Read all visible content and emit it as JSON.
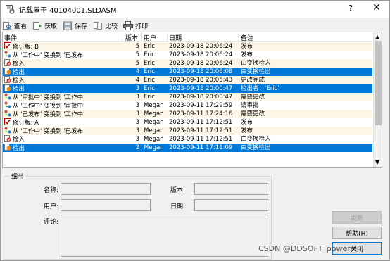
{
  "window": {
    "title": "记载屋于 40104001.SLDASM",
    "help_label": "?",
    "close_label": "✕"
  },
  "toolbar": {
    "items": [
      {
        "label": "查看",
        "icon": "view-icon"
      },
      {
        "label": "获取",
        "icon": "get-icon"
      },
      {
        "label": "保存",
        "icon": "save-icon"
      },
      {
        "label": "比较",
        "icon": "compare-icon"
      },
      {
        "label": "打印",
        "icon": "print-icon"
      }
    ]
  },
  "list": {
    "columns": {
      "event": "事件",
      "version": "版本",
      "user": "用户",
      "date": "日期",
      "note": "备注"
    },
    "rows": [
      {
        "event": "修订版: B",
        "version": "5",
        "user": "Eric",
        "date": "2023-09-18 20:06:24",
        "note": "发布",
        "icon": "revision-icon",
        "style": "cream"
      },
      {
        "event": "从 '工作中' 变换到 '已发布'",
        "version": "5",
        "user": "Eric",
        "date": "2023-09-18 20:06:24",
        "note": "发布",
        "icon": "transition-icon",
        "style": "white"
      },
      {
        "event": "检入",
        "version": "5",
        "user": "Eric",
        "date": "2023-09-18 20:06:24",
        "note": "由变换检入",
        "icon": "checkin-icon",
        "style": "cream"
      },
      {
        "event": "检出",
        "version": "4",
        "user": "Eric",
        "date": "2023-09-18 20:06:08",
        "note": "由变换检出",
        "icon": "checkout-icon",
        "style": "sel"
      },
      {
        "event": "检入",
        "version": "4",
        "user": "Eric",
        "date": "2023-09-18 20:05:43",
        "note": "更改完成",
        "icon": "checkin-icon",
        "style": "cream"
      },
      {
        "event": "检出",
        "version": "3",
        "user": "Eric",
        "date": "2023-09-18 20:00:47",
        "note": "检出者：'Eric'",
        "icon": "checkout-icon",
        "style": "sel"
      },
      {
        "event": "从 '审批中' 变换到 '工作中'",
        "version": "3",
        "user": "Eric",
        "date": "2023-09-18 20:00:47",
        "note": "需要更改",
        "icon": "transition-icon",
        "style": "cream"
      },
      {
        "event": "从 '工作中' 变换到 '审批中'",
        "version": "3",
        "user": "Megan",
        "date": "2023-09-11 17:29:59",
        "note": "请审批",
        "icon": "transition-icon",
        "style": "white"
      },
      {
        "event": "从 '已发布' 变换到 '工作中'",
        "version": "3",
        "user": "Megan",
        "date": "2023-09-11 17:24:16",
        "note": "需要更改",
        "icon": "transition-icon",
        "style": "cream"
      },
      {
        "event": "修订版: A",
        "version": "3",
        "user": "Megan",
        "date": "2023-09-11 17:12:51",
        "note": "发布",
        "icon": "revision-icon",
        "style": "white"
      },
      {
        "event": "从 '工作中' 变换到 '已发布'",
        "version": "3",
        "user": "Megan",
        "date": "2023-09-11 17:12:51",
        "note": "发布",
        "icon": "transition-icon",
        "style": "cream"
      },
      {
        "event": "检入",
        "version": "3",
        "user": "Megan",
        "date": "2023-09-11 17:12:51",
        "note": "由变换检入",
        "icon": "checkin-icon",
        "style": "white"
      },
      {
        "event": "检出",
        "version": "2",
        "user": "Megan",
        "date": "2023-09-11 17:11:09",
        "note": "由变换检出",
        "icon": "checkout-icon",
        "style": "sel"
      }
    ]
  },
  "details": {
    "legend": "细节",
    "name_label": "名称:",
    "version_label": "版本:",
    "user_label": "用户:",
    "date_label": "日期:",
    "comment_label": "评论:"
  },
  "buttons": {
    "update": "更新",
    "help": "帮助(H)",
    "close": "关闭"
  },
  "watermark": "CSDN @DDSOFT_power"
}
